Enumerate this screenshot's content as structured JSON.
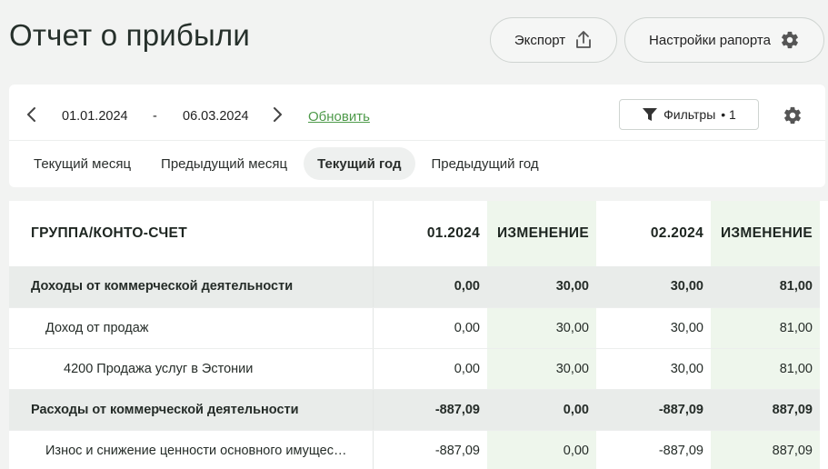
{
  "header": {
    "title": "Отчет о прибыли",
    "export_label": "Экспорт",
    "settings_label": "Настройки рапорта"
  },
  "filters": {
    "date_from": "01.01.2024",
    "date_separator": "-",
    "date_to": "06.03.2024",
    "refresh_label": "Обновить",
    "filters_label": "Фильтры",
    "filters_count": "• 1"
  },
  "period_tabs": [
    {
      "label": "Текущий месяц",
      "active": false
    },
    {
      "label": "Предыдущий месяц",
      "active": false
    },
    {
      "label": "Текущий год",
      "active": true
    },
    {
      "label": "Предыдущий год",
      "active": false
    }
  ],
  "table": {
    "columns": [
      "ГРУППА/КОНТО-СЧЕТ",
      "01.2024",
      "ИЗМЕНЕНИЕ",
      "02.2024",
      "ИЗМЕНЕНИЕ"
    ],
    "rows": [
      {
        "name": "Доходы от коммерческой деятельности",
        "level": "group",
        "values": [
          "0,00",
          "30,00",
          "30,00",
          "81,00"
        ]
      },
      {
        "name": "Доход от продаж",
        "level": "level1",
        "values": [
          "0,00",
          "30,00",
          "30,00",
          "81,00"
        ]
      },
      {
        "name": "4200 Продажа услуг в Эстонии",
        "level": "level2",
        "values": [
          "0,00",
          "30,00",
          "30,00",
          "81,00"
        ]
      },
      {
        "name": "Расходы от коммерческой деятельности",
        "level": "group",
        "values": [
          "-887,09",
          "0,00",
          "-887,09",
          "887,09"
        ]
      },
      {
        "name": "Износ и снижение ценности основного имущес…",
        "level": "level1",
        "values": [
          "-887,09",
          "0,00",
          "-887,09",
          "887,09"
        ]
      }
    ]
  },
  "colors": {
    "accent_link": "#4e9a4a",
    "change_column_bg": "#eef6ec",
    "group_row_bg": "#e9ecea"
  }
}
